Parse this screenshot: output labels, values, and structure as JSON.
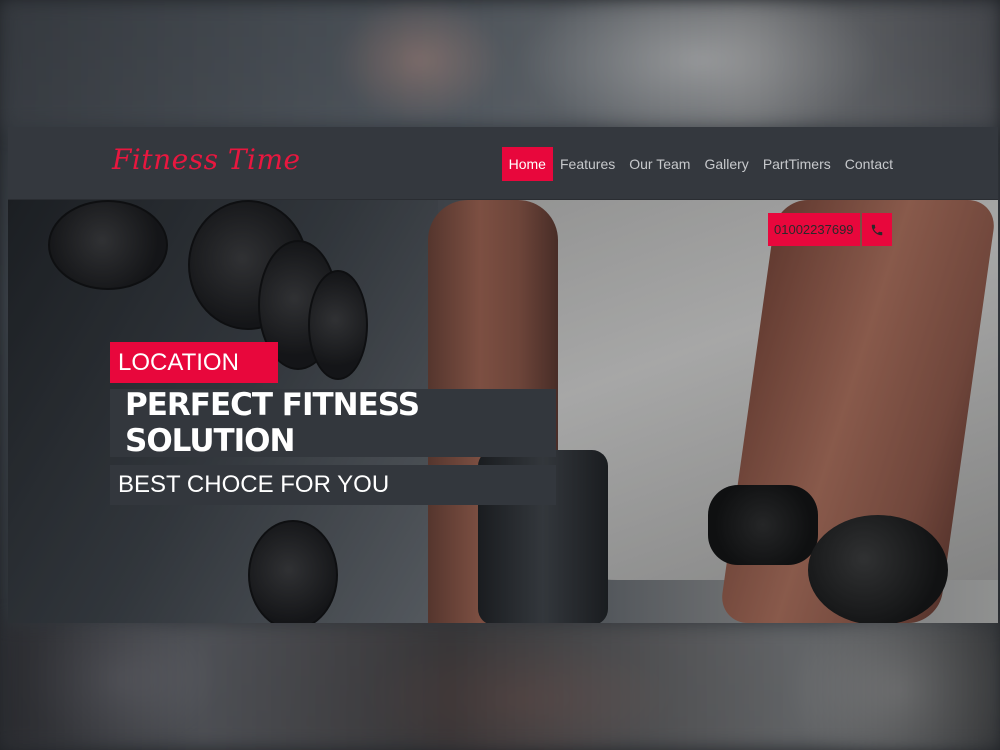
{
  "brand": {
    "name": "Fitness Time",
    "accent": "#e8073c"
  },
  "nav": {
    "items": [
      {
        "label": "Home",
        "active": true
      },
      {
        "label": "Features",
        "active": false
      },
      {
        "label": "Our Team",
        "active": false
      },
      {
        "label": "Gallery",
        "active": false
      },
      {
        "label": "PartTimers",
        "active": false
      },
      {
        "label": "Contact",
        "active": false
      }
    ]
  },
  "contact": {
    "phone": "01002237699",
    "icon": "phone-icon"
  },
  "hero": {
    "tag": "LOCATION",
    "headline": "PERFECT FITNESS SOLUTION",
    "subheadline": "BEST CHOCE FOR YOU"
  }
}
